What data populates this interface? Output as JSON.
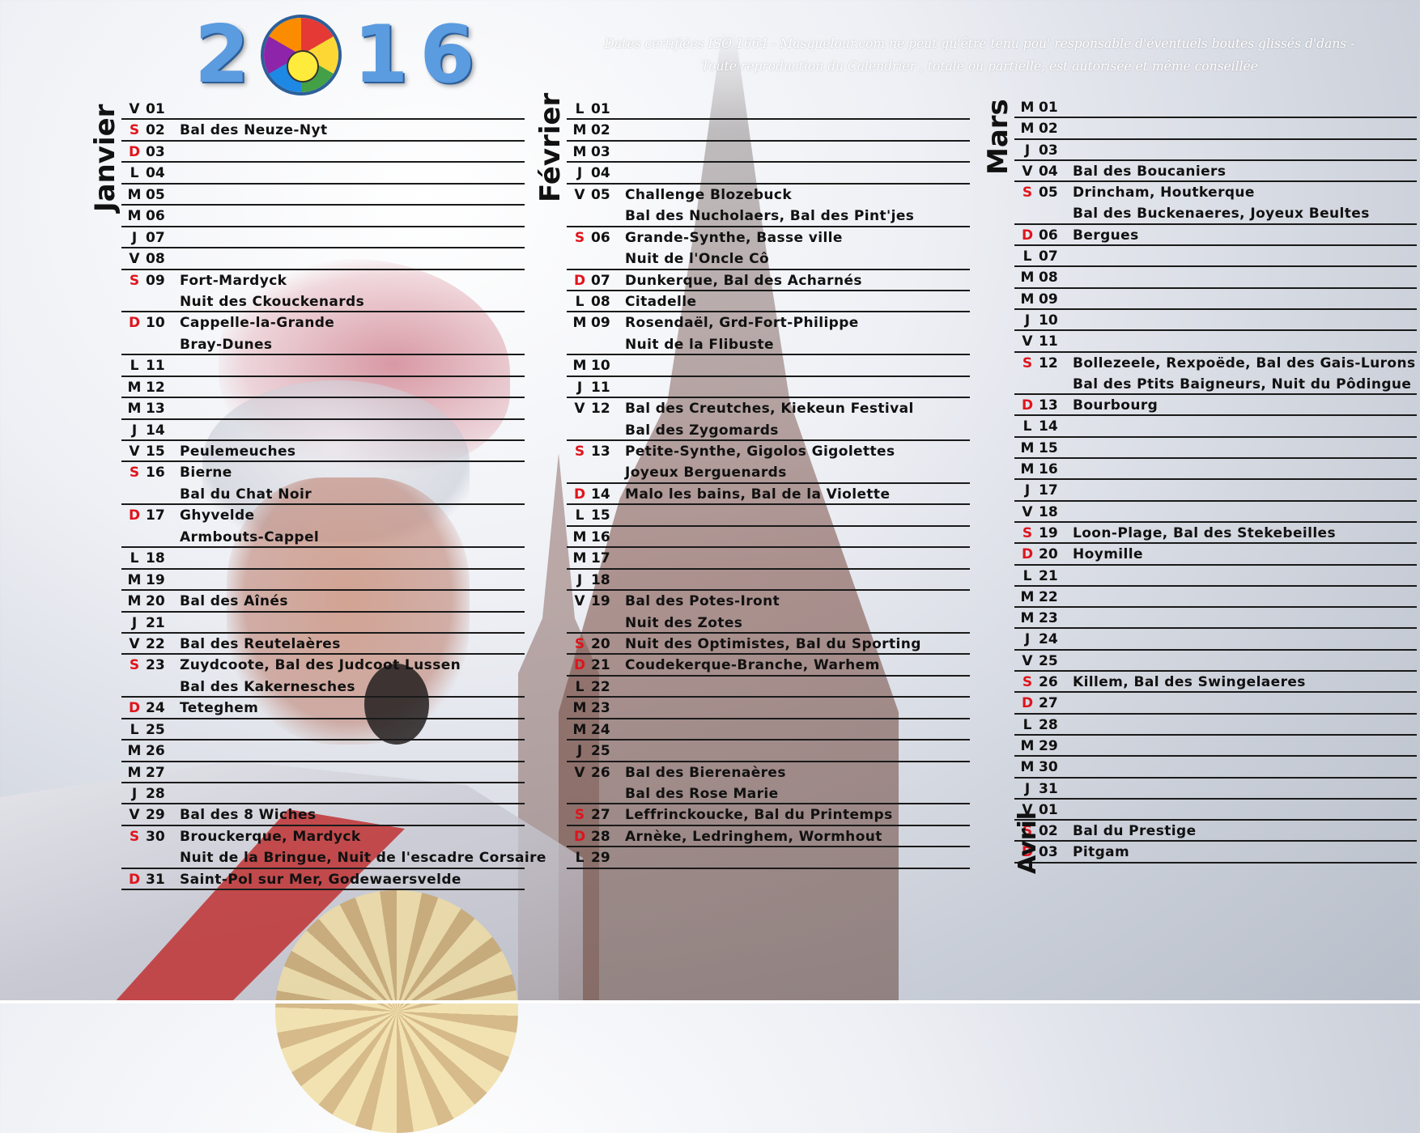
{
  "header": {
    "year_digits": [
      "2",
      "1",
      "6"
    ],
    "logo_text": [
      "MASQUELOUR.com"
    ],
    "notice_line1": "Dates certifiées ISO 1664 - Masquelour.com ne peut qu'être tenu  pou' responsable d'éventuels boutes glissés d'dans -",
    "notice_line2": "Toute reproduction du Calendrier , totale ou partielle, est autorisée et même conseillée"
  },
  "colors": {
    "weekend": "#e0141c",
    "text": "#111111",
    "logo_blue": "#5b9be0"
  },
  "months": [
    {
      "name": "Janvier",
      "rows": [
        {
          "d": "V",
          "n": "01",
          "e": ""
        },
        {
          "d": "S",
          "n": "02",
          "e": "Bal des Neuze-Nyt"
        },
        {
          "d": "D",
          "n": "03",
          "e": ""
        },
        {
          "d": "L",
          "n": "04",
          "e": ""
        },
        {
          "d": "M",
          "n": "05",
          "e": ""
        },
        {
          "d": "M",
          "n": "06",
          "e": ""
        },
        {
          "d": "J",
          "n": "07",
          "e": ""
        },
        {
          "d": "V",
          "n": "08",
          "e": ""
        },
        {
          "d": "S",
          "n": "09",
          "e": "Fort-Mardyck",
          "more": "Nuit des Ckouckenards"
        },
        {
          "d": "D",
          "n": "10",
          "e": "Cappelle-la-Grande",
          "more": "Bray-Dunes"
        },
        {
          "d": "L",
          "n": "11",
          "e": ""
        },
        {
          "d": "M",
          "n": "12",
          "e": ""
        },
        {
          "d": "M",
          "n": "13",
          "e": ""
        },
        {
          "d": "J",
          "n": "14",
          "e": ""
        },
        {
          "d": "V",
          "n": "15",
          "e": "Peulemeuches"
        },
        {
          "d": "S",
          "n": "16",
          "e": "Bierne",
          "more": "Bal du Chat Noir"
        },
        {
          "d": "D",
          "n": "17",
          "e": "Ghyvelde",
          "more": "Armbouts-Cappel"
        },
        {
          "d": "L",
          "n": "18",
          "e": ""
        },
        {
          "d": "M",
          "n": "19",
          "e": ""
        },
        {
          "d": "M",
          "n": "20",
          "e": "Bal des Aînés"
        },
        {
          "d": "J",
          "n": "21",
          "e": ""
        },
        {
          "d": "V",
          "n": "22",
          "e": "Bal des Reutelaères"
        },
        {
          "d": "S",
          "n": "23",
          "e": "Zuydcoote, Bal des Judcoot Lussen",
          "more": "Bal des Kakernesches"
        },
        {
          "d": "D",
          "n": "24",
          "e": "Teteghem"
        },
        {
          "d": "L",
          "n": "25",
          "e": ""
        },
        {
          "d": "M",
          "n": "26",
          "e": ""
        },
        {
          "d": "M",
          "n": "27",
          "e": ""
        },
        {
          "d": "J",
          "n": "28",
          "e": ""
        },
        {
          "d": "V",
          "n": "29",
          "e": "Bal des 8 Wiches"
        },
        {
          "d": "S",
          "n": "30",
          "e": "Brouckerque, Mardyck",
          "more": "Nuit de la Bringue, Nuit de l'escadre Corsaire"
        },
        {
          "d": "D",
          "n": "31",
          "e": "Saint-Pol sur Mer, Godewaersvelde"
        }
      ]
    },
    {
      "name": "Février",
      "rows": [
        {
          "d": "L",
          "n": "01",
          "e": ""
        },
        {
          "d": "M",
          "n": "02",
          "e": ""
        },
        {
          "d": "M",
          "n": "03",
          "e": ""
        },
        {
          "d": "J",
          "n": "04",
          "e": ""
        },
        {
          "d": "V",
          "n": "05",
          "e": "Challenge Blozebuck",
          "more": "Bal des Nucholaers, Bal des Pint'jes"
        },
        {
          "d": "S",
          "n": "06",
          "e": "Grande-Synthe, Basse ville",
          "more": "Nuit de l'Oncle Cô"
        },
        {
          "d": "D",
          "n": "07",
          "e": "Dunkerque, Bal des Acharnés"
        },
        {
          "d": "L",
          "n": "08",
          "e": "Citadelle"
        },
        {
          "d": "M",
          "n": "09",
          "e": "Rosendaël, Grd-Fort-Philippe",
          "more": "Nuit de la Flibuste"
        },
        {
          "d": "M",
          "n": "10",
          "e": ""
        },
        {
          "d": "J",
          "n": "11",
          "e": ""
        },
        {
          "d": "V",
          "n": "12",
          "e": "Bal des Creutches, Kiekeun Festival",
          "more": "Bal des Zygomards"
        },
        {
          "d": "S",
          "n": "13",
          "e": "Petite-Synthe, Gigolos Gigolettes",
          "more": "Joyeux Berguenards"
        },
        {
          "d": "D",
          "n": "14",
          "e": "Malo les bains, Bal de la Violette"
        },
        {
          "d": "L",
          "n": "15",
          "e": ""
        },
        {
          "d": "M",
          "n": "16",
          "e": ""
        },
        {
          "d": "M",
          "n": "17",
          "e": ""
        },
        {
          "d": "J",
          "n": "18",
          "e": ""
        },
        {
          "d": "V",
          "n": "19",
          "e": "Bal des Potes-Iront",
          "more": "Nuit des Zotes"
        },
        {
          "d": "S",
          "n": "20",
          "e": "Nuit des Optimistes, Bal du Sporting"
        },
        {
          "d": "D",
          "n": "21",
          "e": "Coudekerque-Branche, Warhem"
        },
        {
          "d": "L",
          "n": "22",
          "e": ""
        },
        {
          "d": "M",
          "n": "23",
          "e": ""
        },
        {
          "d": "M",
          "n": "24",
          "e": ""
        },
        {
          "d": "J",
          "n": "25",
          "e": ""
        },
        {
          "d": "V",
          "n": "26",
          "e": "Bal des  Bierenaères",
          "more": "Bal des Rose Marie"
        },
        {
          "d": "S",
          "n": "27",
          "e": "Leffrinckoucke, Bal du Printemps"
        },
        {
          "d": "D",
          "n": "28",
          "e": "Arnèke, Ledringhem, Wormhout"
        },
        {
          "d": "L",
          "n": "29",
          "e": ""
        }
      ]
    },
    {
      "name": "Mars",
      "rows": [
        {
          "d": "M",
          "n": "01",
          "e": ""
        },
        {
          "d": "M",
          "n": "02",
          "e": ""
        },
        {
          "d": "J",
          "n": "03",
          "e": ""
        },
        {
          "d": "V",
          "n": "04",
          "e": "Bal des Boucaniers"
        },
        {
          "d": "S",
          "n": "05",
          "e": "Drincham, Houtkerque",
          "more": "Bal des Buckenaeres, Joyeux Beultes"
        },
        {
          "d": "D",
          "n": "06",
          "e": "Bergues"
        },
        {
          "d": "L",
          "n": "07",
          "e": ""
        },
        {
          "d": "M",
          "n": "08",
          "e": ""
        },
        {
          "d": "M",
          "n": "09",
          "e": ""
        },
        {
          "d": "J",
          "n": "10",
          "e": ""
        },
        {
          "d": "V",
          "n": "11",
          "e": ""
        },
        {
          "d": "S",
          "n": "12",
          "e": "Bollezeele, Rexpoëde, Bal des Gais-Lurons",
          "more": "Bal des Ptits Baigneurs, Nuit du Pôdingue"
        },
        {
          "d": "D",
          "n": "13",
          "e": "Bourbourg"
        },
        {
          "d": "L",
          "n": "14",
          "e": ""
        },
        {
          "d": "M",
          "n": "15",
          "e": ""
        },
        {
          "d": "M",
          "n": "16",
          "e": ""
        },
        {
          "d": "J",
          "n": "17",
          "e": ""
        },
        {
          "d": "V",
          "n": "18",
          "e": ""
        },
        {
          "d": "S",
          "n": "19",
          "e": "Loon-Plage, Bal des Stekebeilles"
        },
        {
          "d": "D",
          "n": "20",
          "e": "Hoymille"
        },
        {
          "d": "L",
          "n": "21",
          "e": ""
        },
        {
          "d": "M",
          "n": "22",
          "e": ""
        },
        {
          "d": "M",
          "n": "23",
          "e": ""
        },
        {
          "d": "J",
          "n": "24",
          "e": ""
        },
        {
          "d": "V",
          "n": "25",
          "e": ""
        },
        {
          "d": "S",
          "n": "26",
          "e": "Killem, Bal des Swingelaeres"
        },
        {
          "d": "D",
          "n": "27",
          "e": ""
        },
        {
          "d": "L",
          "n": "28",
          "e": ""
        },
        {
          "d": "M",
          "n": "29",
          "e": ""
        },
        {
          "d": "M",
          "n": "30",
          "e": ""
        },
        {
          "d": "J",
          "n": "31",
          "e": ""
        },
        {
          "d": "V",
          "n": "01",
          "e": ""
        },
        {
          "d": "S",
          "n": "02",
          "e": "Bal du Prestige"
        },
        {
          "d": "D",
          "n": "03",
          "e": "Pitgam"
        }
      ]
    }
  ],
  "april_label": "Avril"
}
